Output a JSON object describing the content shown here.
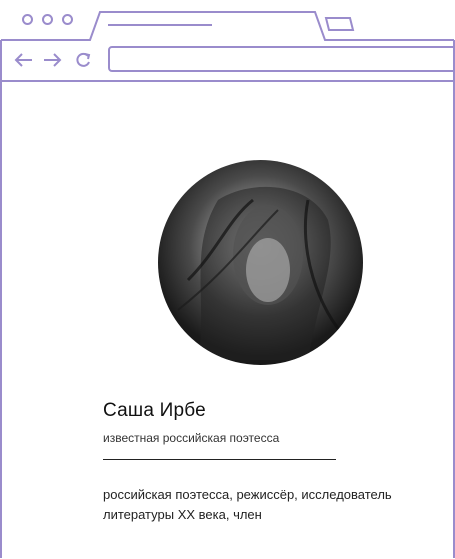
{
  "profile": {
    "name": "Саша Ирбе",
    "subtitle": "известная российская поэтесса",
    "bio": "российская поэтесса, режиссёр, исследователь литературы XX века, член"
  },
  "colors": {
    "browser_outline": "#9a8ccc",
    "text": "#111111"
  },
  "icons": {
    "back": "arrow-left",
    "forward": "arrow-right",
    "reload": "reload"
  }
}
